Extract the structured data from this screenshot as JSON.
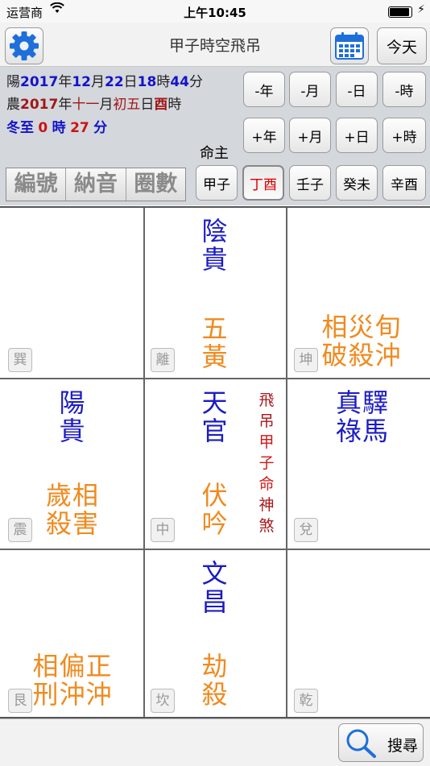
{
  "status": {
    "carrier": "运营商",
    "time": "上午10:45"
  },
  "nav": {
    "title": "甲子時空飛吊",
    "today": "今天"
  },
  "info": {
    "solar": {
      "prefix": "陽",
      "year": "2017",
      "y": "年",
      "month": "12",
      "m": "月",
      "day": "22",
      "d": "日",
      "hour": "18",
      "h": "時",
      "minute": "44",
      "mi": "分"
    },
    "lunar": {
      "prefix": "農",
      "year": "2017",
      "y": "年",
      "month": "十一",
      "m": "月",
      "day": "初五",
      "d": "日",
      "hour": "酉",
      "h": "時"
    },
    "term": {
      "name": "冬至",
      "hours": "0",
      "h": "時",
      "minutes": "27",
      "mi": "分"
    },
    "mingzhu": "命主"
  },
  "adjust": [
    "-年",
    "-月",
    "-日",
    "-時",
    "+年",
    "+月",
    "+日",
    "+時"
  ],
  "tabs": [
    "編號",
    "納音",
    "圈數"
  ],
  "pillars": [
    "甲子",
    "丁酉",
    "壬子",
    "癸未",
    "辛酉"
  ],
  "selected_pillar": 1,
  "cells": {
    "xun": {
      "gua": "巽"
    },
    "li": {
      "gua": "離",
      "top": [
        "陰",
        "貴"
      ],
      "bottom": [
        "五",
        "黃"
      ]
    },
    "kun": {
      "gua": "坤",
      "bottom": [
        "相災旬",
        "破殺沖"
      ]
    },
    "zhen": {
      "gua": "震",
      "top": [
        "陽",
        "貴"
      ],
      "bottom": [
        "歲相",
        "殺害"
      ]
    },
    "zhong": {
      "gua": "中",
      "top": [
        "天",
        "官"
      ],
      "bottom": [
        "伏",
        "吟"
      ],
      "vertical": [
        "飛",
        "吊",
        "甲",
        "子",
        "命",
        "神",
        "煞"
      ]
    },
    "dui": {
      "gua": "兌",
      "top": [
        "真驛",
        "祿馬"
      ]
    },
    "gen": {
      "gua": "艮",
      "bottom": [
        "相偏正",
        "刑沖沖"
      ]
    },
    "kan": {
      "gua": "坎",
      "top": [
        "文",
        "昌"
      ],
      "bottom": [
        "劫",
        "殺"
      ]
    },
    "qian": {
      "gua": "乾"
    }
  },
  "search": "搜尋",
  "colors": {
    "blue": "#1c1cc4",
    "orange": "#f08a1e",
    "red": "#c81414",
    "maroon": "#a01818",
    "gear": "#1e6fd9"
  }
}
